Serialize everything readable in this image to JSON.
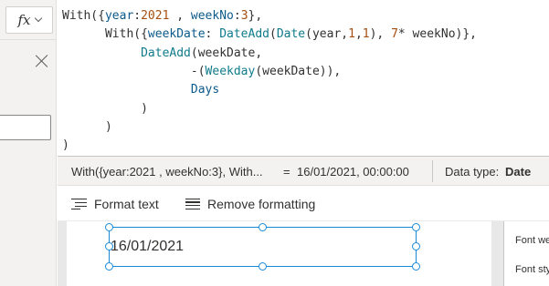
{
  "formula_bar": {
    "fx_label": "fx",
    "lines": [
      [
        {
          "t": "With({",
          "c": "p"
        },
        {
          "t": "year",
          "c": "k"
        },
        {
          "t": ":",
          "c": "p"
        },
        {
          "t": "2021",
          "c": "n"
        },
        {
          "t": " , ",
          "c": "p"
        },
        {
          "t": "weekNo",
          "c": "k"
        },
        {
          "t": ":",
          "c": "p"
        },
        {
          "t": "3",
          "c": "n"
        },
        {
          "t": "},",
          "c": "p"
        }
      ],
      [
        {
          "t": "      With({",
          "c": "p"
        },
        {
          "t": "weekDate",
          "c": "k"
        },
        {
          "t": ": ",
          "c": "p"
        },
        {
          "t": "DateAdd",
          "c": "f"
        },
        {
          "t": "(",
          "c": "p"
        },
        {
          "t": "Date",
          "c": "f"
        },
        {
          "t": "(year,",
          "c": "p"
        },
        {
          "t": "1",
          "c": "n"
        },
        {
          "t": ",",
          "c": "p"
        },
        {
          "t": "1",
          "c": "n"
        },
        {
          "t": "), ",
          "c": "p"
        },
        {
          "t": "7",
          "c": "n"
        },
        {
          "t": "* weekNo)},",
          "c": "p"
        }
      ],
      [
        {
          "t": "           ",
          "c": "p"
        },
        {
          "t": "DateAdd",
          "c": "f"
        },
        {
          "t": "(weekDate,",
          "c": "p"
        }
      ],
      [
        {
          "t": "                  -(",
          "c": "p"
        },
        {
          "t": "Weekday",
          "c": "f"
        },
        {
          "t": "(weekDate)),",
          "c": "p"
        }
      ],
      [
        {
          "t": "                  ",
          "c": "p"
        },
        {
          "t": "Days",
          "c": "k"
        }
      ],
      [
        {
          "t": "           )",
          "c": "p"
        }
      ],
      [
        {
          "t": "      )",
          "c": "p"
        }
      ],
      [
        {
          "t": ")",
          "c": "p"
        }
      ]
    ]
  },
  "result_bar": {
    "expression": "With({year:2021 , weekNo:3}, With...",
    "equals": "=",
    "value": "16/01/2021, 00:00:00",
    "data_type_label": "Data type:",
    "data_type_value": "Date"
  },
  "toolbar": {
    "format_text_label": "Format text",
    "remove_formatting_label": "Remove formatting"
  },
  "canvas": {
    "label_text": "16/01/2021"
  },
  "properties": {
    "font_weight_label": "Font weight",
    "font_style_label": "Font style"
  },
  "colors": {
    "selection": "#1a8ad8",
    "keyword": "#0b5a8a",
    "function": "#0f7b8a",
    "number": "#a44f10"
  }
}
